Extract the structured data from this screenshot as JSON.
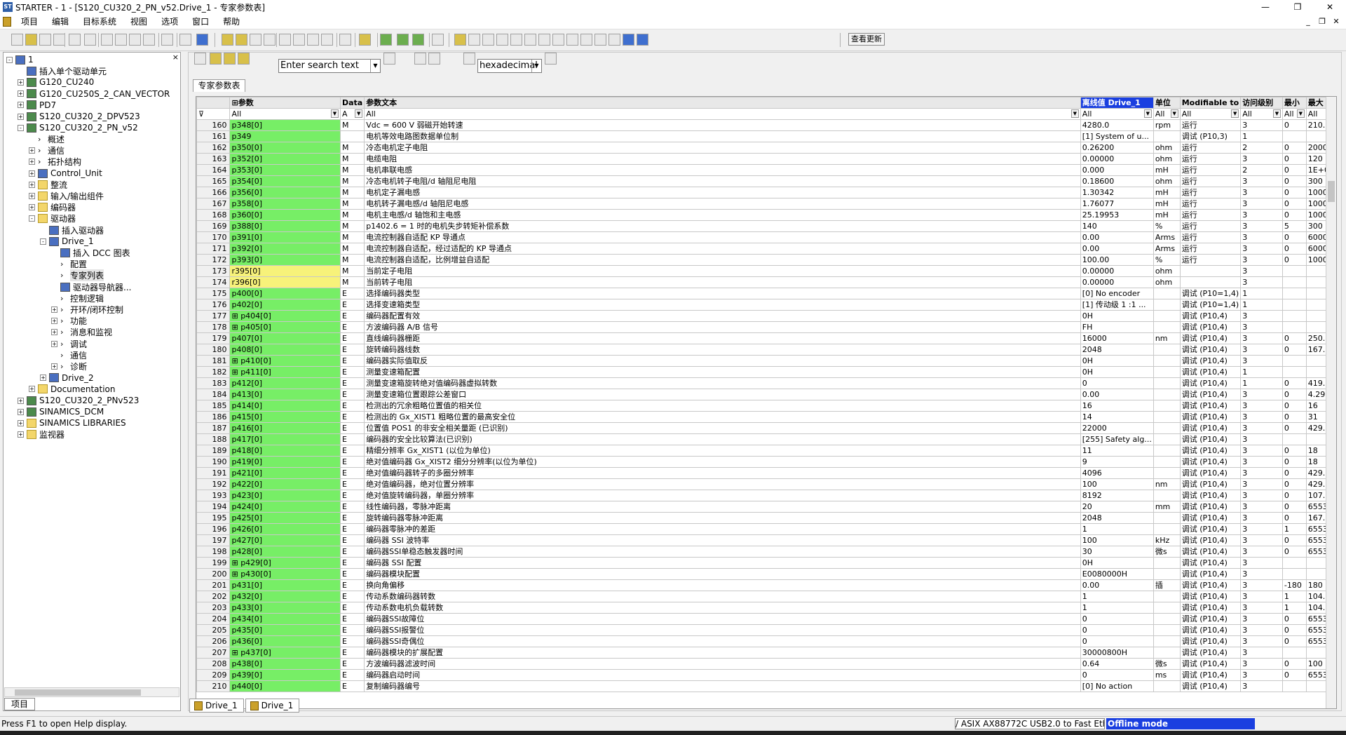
{
  "window": {
    "title": "STARTER - 1 - [S120_CU320_2_PN_v52.Drive_1 - 专家参数表]",
    "app_icon": "ST",
    "min": "—",
    "max": "❐",
    "close": "✕"
  },
  "menu": [
    "项目",
    "编辑",
    "目标系统",
    "视图",
    "选项",
    "窗口",
    "帮助"
  ],
  "mdi": {
    "min": "_",
    "restore": "❐",
    "close": "✕"
  },
  "toolbar": {
    "update_label": "查看更新"
  },
  "project_panel": {
    "close": "×",
    "tab": "项目",
    "tree": [
      {
        "label": "1",
        "level": 0,
        "exp": "-",
        "icon": "blue"
      },
      {
        "label": "插入单个驱动单元",
        "level": 1,
        "exp": "",
        "icon": "blue"
      },
      {
        "label": "G120_CU240",
        "level": 1,
        "exp": "+",
        "icon": "drv"
      },
      {
        "label": "G120_CU250S_2_CAN_VECTOR",
        "level": 1,
        "exp": "+",
        "icon": "drv"
      },
      {
        "label": "PD7",
        "level": 1,
        "exp": "+",
        "icon": "drv"
      },
      {
        "label": "S120_CU320_2_DPV523",
        "level": 1,
        "exp": "+",
        "icon": "drv"
      },
      {
        "label": "S120_CU320_2_PN_v52",
        "level": 1,
        "exp": "-",
        "icon": "drv"
      },
      {
        "label": "概述",
        "level": 2,
        "exp": "",
        "icon": "arr"
      },
      {
        "label": "通信",
        "level": 2,
        "exp": "+",
        "icon": "arr"
      },
      {
        "label": "拓扑结构",
        "level": 2,
        "exp": "+",
        "icon": "arr"
      },
      {
        "label": "Control_Unit",
        "level": 2,
        "exp": "+",
        "icon": "blue"
      },
      {
        "label": "整流",
        "level": 2,
        "exp": "+",
        "icon": "folder"
      },
      {
        "label": "输入/输出组件",
        "level": 2,
        "exp": "+",
        "icon": "folder"
      },
      {
        "label": "编码器",
        "level": 2,
        "exp": "+",
        "icon": "folder"
      },
      {
        "label": "驱动器",
        "level": 2,
        "exp": "-",
        "icon": "folder"
      },
      {
        "label": "插入驱动器",
        "level": 3,
        "exp": "",
        "icon": "blue"
      },
      {
        "label": "Drive_1",
        "level": 3,
        "exp": "-",
        "icon": "blue"
      },
      {
        "label": "插入 DCC 图表",
        "level": 4,
        "exp": "",
        "icon": "blue"
      },
      {
        "label": "配置",
        "level": 4,
        "exp": "",
        "icon": "arr"
      },
      {
        "label": "专家列表",
        "level": 4,
        "exp": "",
        "icon": "arr",
        "sel": true
      },
      {
        "label": "驱动器导航器...",
        "level": 4,
        "exp": "",
        "icon": "blue"
      },
      {
        "label": "控制逻辑",
        "level": 4,
        "exp": "",
        "icon": "arr"
      },
      {
        "label": "开环/闭环控制",
        "level": 4,
        "exp": "+",
        "icon": "arr"
      },
      {
        "label": "功能",
        "level": 4,
        "exp": "+",
        "icon": "arr"
      },
      {
        "label": "消息和监视",
        "level": 4,
        "exp": "+",
        "icon": "arr"
      },
      {
        "label": "调试",
        "level": 4,
        "exp": "+",
        "icon": "arr"
      },
      {
        "label": "通信",
        "level": 4,
        "exp": "",
        "icon": "arr"
      },
      {
        "label": "诊断",
        "level": 4,
        "exp": "+",
        "icon": "arr"
      },
      {
        "label": "Drive_2",
        "level": 3,
        "exp": "+",
        "icon": "blue"
      },
      {
        "label": "Documentation",
        "level": 2,
        "exp": "+",
        "icon": "folder"
      },
      {
        "label": "S120_CU320_2_PNv523",
        "level": 1,
        "exp": "+",
        "icon": "drv"
      },
      {
        "label": "SINAMICS_DCM",
        "level": 1,
        "exp": "+",
        "icon": "drv"
      },
      {
        "label": "SINAMICS LIBRARIES",
        "level": 1,
        "exp": "+",
        "icon": "folder"
      },
      {
        "label": "监视器",
        "level": 1,
        "exp": "+",
        "icon": "folder"
      }
    ]
  },
  "expert": {
    "tab": "专家参数表",
    "search_placeholder": "Enter search text",
    "format": "hexadecimal",
    "headers": {
      "param": "⊞参数",
      "data": "Data",
      "text": "参数文本",
      "offline": "离线值 Drive_1",
      "unit": "单位",
      "modifiable": "Modifiable to",
      "access": "访问级别",
      "min": "最小",
      "max": "最大"
    },
    "filters": {
      "param": "All",
      "data": "A",
      "text": "All",
      "offline": "All",
      "unit": "All",
      "modifiable": "All",
      "access": "All",
      "min": "All",
      "max": "All"
    },
    "rows": [
      [
        "160",
        "p348[0]",
        "M",
        "Vdc = 600 V 弱磁开始转速",
        "4280.0",
        "rpm",
        "运行",
        "3",
        "0",
        "210...",
        ""
      ],
      [
        "161",
        "p349",
        "",
        "电机等效电路图数据单位制",
        "[1] System of u...",
        "",
        "调试 (P10,3)",
        "1",
        "",
        "",
        ""
      ],
      [
        "162",
        "p350[0]",
        "M",
        "冷态电机定子电阻",
        "0.26200",
        "ohm",
        "运行",
        "2",
        "0",
        "2000",
        ""
      ],
      [
        "163",
        "p352[0]",
        "M",
        "电缆电阻",
        "0.00000",
        "ohm",
        "运行",
        "3",
        "0",
        "120",
        ""
      ],
      [
        "164",
        "p353[0]",
        "M",
        "电机串联电感",
        "0.000",
        "mH",
        "运行",
        "2",
        "0",
        "1E+06",
        ""
      ],
      [
        "165",
        "p354[0]",
        "M",
        "冷态电机转子电阻/d 轴阻尼电阻",
        "0.18600",
        "ohm",
        "运行",
        "3",
        "0",
        "300",
        ""
      ],
      [
        "166",
        "p356[0]",
        "M",
        "电机定子漏电感",
        "1.30342",
        "mH",
        "运行",
        "3",
        "0",
        "1000",
        ""
      ],
      [
        "167",
        "p358[0]",
        "M",
        "电机转子漏电感/d 轴阻尼电感",
        "1.76077",
        "mH",
        "运行",
        "3",
        "0",
        "1000",
        ""
      ],
      [
        "168",
        "p360[0]",
        "M",
        "电机主电感/d 轴饱和主电感",
        "25.19953",
        "mH",
        "运行",
        "3",
        "0",
        "10000",
        ""
      ],
      [
        "169",
        "p388[0]",
        "M",
        "p1402.6 = 1 时的电机失步转矩补偿系数",
        "140",
        "%",
        "运行",
        "3",
        "5",
        "300",
        ""
      ],
      [
        "170",
        "p391[0]",
        "M",
        "电流控制器自适配 KP 导通点",
        "0.00",
        "Arms",
        "运行",
        "3",
        "0",
        "6000",
        ""
      ],
      [
        "171",
        "p392[0]",
        "M",
        "电流控制器自适配，经过适配的 KP 导通点",
        "0.00",
        "Arms",
        "运行",
        "3",
        "0",
        "6000",
        ""
      ],
      [
        "172",
        "p393[0]",
        "M",
        "电流控制器自适配，比例增益自适配",
        "100.00",
        "%",
        "运行",
        "3",
        "0",
        "1000",
        ""
      ],
      [
        "173",
        "r395[0]",
        "M",
        "当前定子电阻",
        "0.00000",
        "ohm",
        "",
        "3",
        "",
        "",
        "y"
      ],
      [
        "174",
        "r396[0]",
        "M",
        "当前转子电阻",
        "0.00000",
        "ohm",
        "",
        "3",
        "",
        "",
        "y"
      ],
      [
        "175",
        "p400[0]",
        "E",
        "选择编码器类型",
        "[0] No encoder",
        "",
        "调试 (P10=1,4)",
        "1",
        "",
        "",
        ""
      ],
      [
        "176",
        "p402[0]",
        "E",
        "选择变速箱类型",
        "[1] 传动级 1 :1 ...",
        "",
        "调试 (P10=1,4)",
        "1",
        "",
        "",
        ""
      ],
      [
        "177",
        "⊞ p404[0]",
        "E",
        "编码器配置有效",
        "0H",
        "",
        "调试 (P10,4)",
        "3",
        "",
        "",
        ""
      ],
      [
        "178",
        "⊞ p405[0]",
        "E",
        "方波编码器 A/B 信号",
        "FH",
        "",
        "调试 (P10,4)",
        "3",
        "",
        "",
        ""
      ],
      [
        "179",
        "p407[0]",
        "E",
        "直线编码器栅距",
        "16000",
        "nm",
        "调试 (P10,4)",
        "3",
        "0",
        "250...",
        ""
      ],
      [
        "180",
        "p408[0]",
        "E",
        "旋转编码器线数",
        "2048",
        "",
        "调试 (P10,4)",
        "3",
        "0",
        "167...",
        ""
      ],
      [
        "181",
        "⊞ p410[0]",
        "E",
        "编码器实际值取反",
        "0H",
        "",
        "调试 (P10,4)",
        "3",
        "",
        "",
        ""
      ],
      [
        "182",
        "⊞ p411[0]",
        "E",
        "测量变速箱配置",
        "0H",
        "",
        "调试 (P10,4)",
        "1",
        "",
        "",
        ""
      ],
      [
        "183",
        "p412[0]",
        "E",
        "测量变速箱旋转绝对值编码器虚拟转数",
        "0",
        "",
        "调试 (P10,4)",
        "1",
        "0",
        "419...",
        ""
      ],
      [
        "184",
        "p413[0]",
        "E",
        "测量变速箱位置跟踪公差窗口",
        "0.00",
        "",
        "调试 (P10,4)",
        "3",
        "0",
        "4.29...",
        ""
      ],
      [
        "185",
        "p414[0]",
        "E",
        "检测出的冗余粗略位置值的相关位",
        "16",
        "",
        "调试 (P10,4)",
        "3",
        "0",
        "16",
        ""
      ],
      [
        "186",
        "p415[0]",
        "E",
        "检测出的 Gx_XIST1 粗略位置的最高安全位",
        "14",
        "",
        "调试 (P10,4)",
        "3",
        "0",
        "31",
        ""
      ],
      [
        "187",
        "p416[0]",
        "E",
        "位置值 POS1 的非安全相关量距 (已识别)",
        "22000",
        "",
        "调试 (P10,4)",
        "3",
        "0",
        "429...",
        ""
      ],
      [
        "188",
        "p417[0]",
        "E",
        "编码器的安全比较算法(已识别)",
        "[255] Safety alg...",
        "",
        "调试 (P10,4)",
        "3",
        "",
        "",
        ""
      ],
      [
        "189",
        "p418[0]",
        "E",
        "精细分辨率 Gx_XIST1 (以位为单位)",
        "11",
        "",
        "调试 (P10,4)",
        "3",
        "0",
        "18",
        ""
      ],
      [
        "190",
        "p419[0]",
        "E",
        "绝对值编码器 Gx_XIST2 细分分辨率(以位为单位)",
        "9",
        "",
        "调试 (P10,4)",
        "3",
        "0",
        "18",
        ""
      ],
      [
        "191",
        "p421[0]",
        "E",
        "绝对值编码器转子的多圈分辨率",
        "4096",
        "",
        "调试 (P10,4)",
        "3",
        "0",
        "429...",
        ""
      ],
      [
        "192",
        "p422[0]",
        "E",
        "绝对值编码器，绝对位置分辨率",
        "100",
        "nm",
        "调试 (P10,4)",
        "3",
        "0",
        "429...",
        ""
      ],
      [
        "193",
        "p423[0]",
        "E",
        "绝对值旋转编码器，单圈分辨率",
        "8192",
        "",
        "调试 (P10,4)",
        "3",
        "0",
        "107...",
        ""
      ],
      [
        "194",
        "p424[0]",
        "E",
        "线性编码器，零脉冲距离",
        "20",
        "mm",
        "调试 (P10,4)",
        "3",
        "0",
        "65535",
        ""
      ],
      [
        "195",
        "p425[0]",
        "E",
        "旋转编码器零脉冲距离",
        "2048",
        "",
        "调试 (P10,4)",
        "3",
        "0",
        "167...",
        ""
      ],
      [
        "196",
        "p426[0]",
        "E",
        "编码器零脉冲的差距",
        "1",
        "",
        "调试 (P10,4)",
        "3",
        "1",
        "65535",
        ""
      ],
      [
        "197",
        "p427[0]",
        "E",
        "编码器 SSI 波特率",
        "100",
        "kHz",
        "调试 (P10,4)",
        "3",
        "0",
        "65535",
        ""
      ],
      [
        "198",
        "p428[0]",
        "E",
        "编码器SSI单稳态触发器时间",
        "30",
        "微s",
        "调试 (P10,4)",
        "3",
        "0",
        "65535",
        ""
      ],
      [
        "199",
        "⊞ p429[0]",
        "E",
        "编码器 SSI 配置",
        "0H",
        "",
        "调试 (P10,4)",
        "3",
        "",
        "",
        ""
      ],
      [
        "200",
        "⊞ p430[0]",
        "E",
        "编码器模块配置",
        "E0080000H",
        "",
        "调试 (P10,4)",
        "3",
        "",
        "",
        ""
      ],
      [
        "201",
        "p431[0]",
        "E",
        "换向角偏移",
        "0.00",
        "插",
        "调试 (P10,4)",
        "3",
        "-180",
        "180",
        ""
      ],
      [
        "202",
        "p432[0]",
        "E",
        "传动系数编码器转数",
        "1",
        "",
        "调试 (P10,4)",
        "3",
        "1",
        "104...",
        ""
      ],
      [
        "203",
        "p433[0]",
        "E",
        "传动系数电机负载转数",
        "1",
        "",
        "调试 (P10,4)",
        "3",
        "1",
        "104...",
        ""
      ],
      [
        "204",
        "p434[0]",
        "E",
        "编码器SSI故障位",
        "0",
        "",
        "调试 (P10,4)",
        "3",
        "0",
        "65535",
        ""
      ],
      [
        "205",
        "p435[0]",
        "E",
        "编码器SSI报警位",
        "0",
        "",
        "调试 (P10,4)",
        "3",
        "0",
        "65535",
        ""
      ],
      [
        "206",
        "p436[0]",
        "E",
        "编码器SSI奇偶位",
        "0",
        "",
        "调试 (P10,4)",
        "3",
        "0",
        "65535",
        ""
      ],
      [
        "207",
        "⊞ p437[0]",
        "E",
        "编码器模块的扩展配置",
        "30000800H",
        "",
        "调试 (P10,4)",
        "3",
        "",
        "",
        ""
      ],
      [
        "208",
        "p438[0]",
        "E",
        "方波编码器滤波时间",
        "0.64",
        "微s",
        "调试 (P10,4)",
        "3",
        "0",
        "100",
        ""
      ],
      [
        "209",
        "p439[0]",
        "E",
        "编码器启动时间",
        "0",
        "ms",
        "调试 (P10,4)",
        "3",
        "0",
        "65535",
        ""
      ],
      [
        "210",
        "p440[0]",
        "E",
        "复制编码器编号",
        "[0] No action",
        "",
        "调试 (P10,4)",
        "3",
        "",
        "",
        ""
      ]
    ]
  },
  "bottom_tabs": [
    "Drive_1",
    "Drive_1"
  ],
  "status": {
    "help": "Press F1 to open Help display.",
    "network": "/ ASIX AX88772C USB2.0 to Fast Eth",
    "mode": "Offline mode"
  }
}
